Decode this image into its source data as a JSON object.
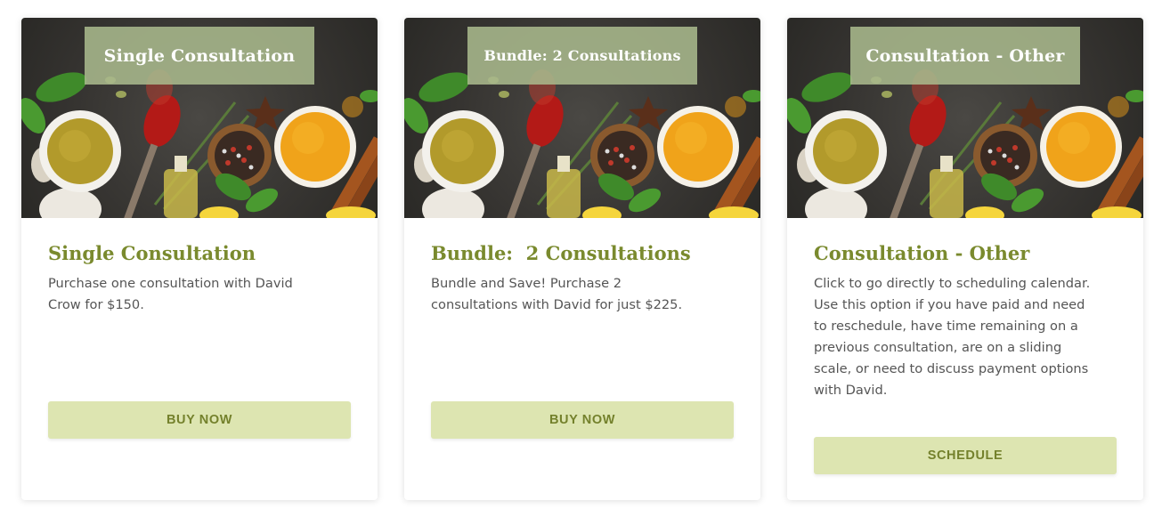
{
  "cards": [
    {
      "overlay_title": "Single Consultation",
      "title": "Single Consultation",
      "description": "Purchase one consultation with David\nCrow for $150.",
      "button_label": "BUY NOW"
    },
    {
      "overlay_title": "Bundle: 2 Consultations",
      "title": "Bundle:  2 Consultations",
      "description": "Bundle and Save!  Purchase 2\nconsultations with David for just $225.",
      "button_label": "BUY NOW"
    },
    {
      "overlay_title": "Consultation - Other",
      "title": "Consultation - Other",
      "description": "Click to go directly to scheduling calendar.\nUse this option if you have paid and need\nto reschedule, have time remaining on a\nprevious consultation, are on a sliding\nscale, or need to discuss payment options\nwith David.",
      "button_label": "SCHEDULE"
    }
  ],
  "colors": {
    "title_green": "#7a8a2e",
    "button_bg": "#dde5b1",
    "button_text": "#74812c",
    "overlay_bg": "#a9b88c",
    "body_text": "#555555"
  },
  "images": {
    "banner": "spices-banner-image"
  }
}
